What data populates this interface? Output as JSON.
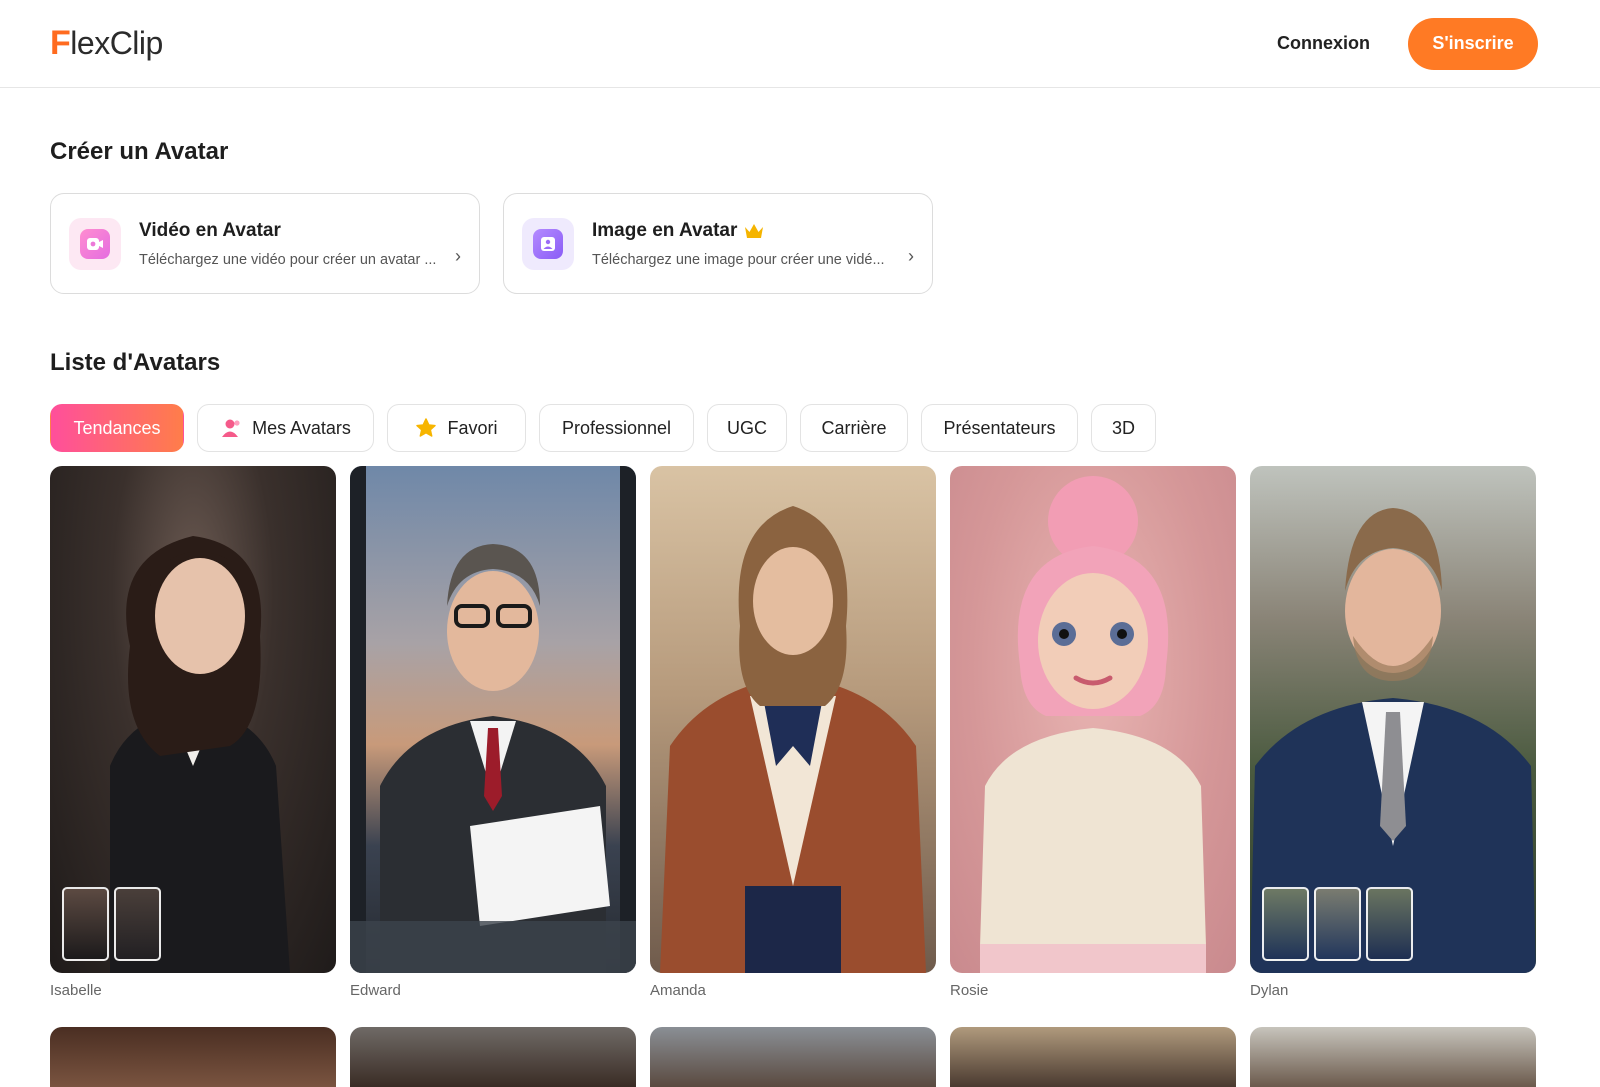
{
  "header": {
    "logo_first": "F",
    "logo_rest": "lexClip",
    "login_label": "Connexion",
    "signup_label": "S'inscrire"
  },
  "create_section": {
    "title": "Créer un Avatar",
    "cards": [
      {
        "title": "Vidéo en Avatar",
        "description": "Téléchargez une vidéo pour créer un avatar ...",
        "icon": "video-avatar-icon",
        "premium": false
      },
      {
        "title": "Image en Avatar",
        "description": "Téléchargez une image pour créer une vidé...",
        "icon": "image-avatar-icon",
        "premium": true
      }
    ]
  },
  "list_section": {
    "title": "Liste d'Avatars",
    "tabs": [
      {
        "label": "Tendances",
        "active": true
      },
      {
        "label": "Mes Avatars",
        "icon": "user-avatar-icon"
      },
      {
        "label": "Favori",
        "icon": "star-icon"
      },
      {
        "label": "Professionnel"
      },
      {
        "label": "UGC"
      },
      {
        "label": "Carrière"
      },
      {
        "label": "Présentateurs"
      },
      {
        "label": "3D"
      }
    ],
    "avatars": [
      {
        "name": "Isabelle",
        "thumb_count": 2
      },
      {
        "name": "Edward",
        "thumb_count": 0
      },
      {
        "name": "Amanda",
        "thumb_count": 0
      },
      {
        "name": "Rosie",
        "thumb_count": 0
      },
      {
        "name": "Dylan",
        "thumb_count": 3
      }
    ]
  },
  "colors": {
    "brand_orange": "#ff7a24",
    "active_tab_start": "#ff4f9b",
    "active_tab_end": "#ff7d4a",
    "premium_crown": "#f5b400"
  }
}
